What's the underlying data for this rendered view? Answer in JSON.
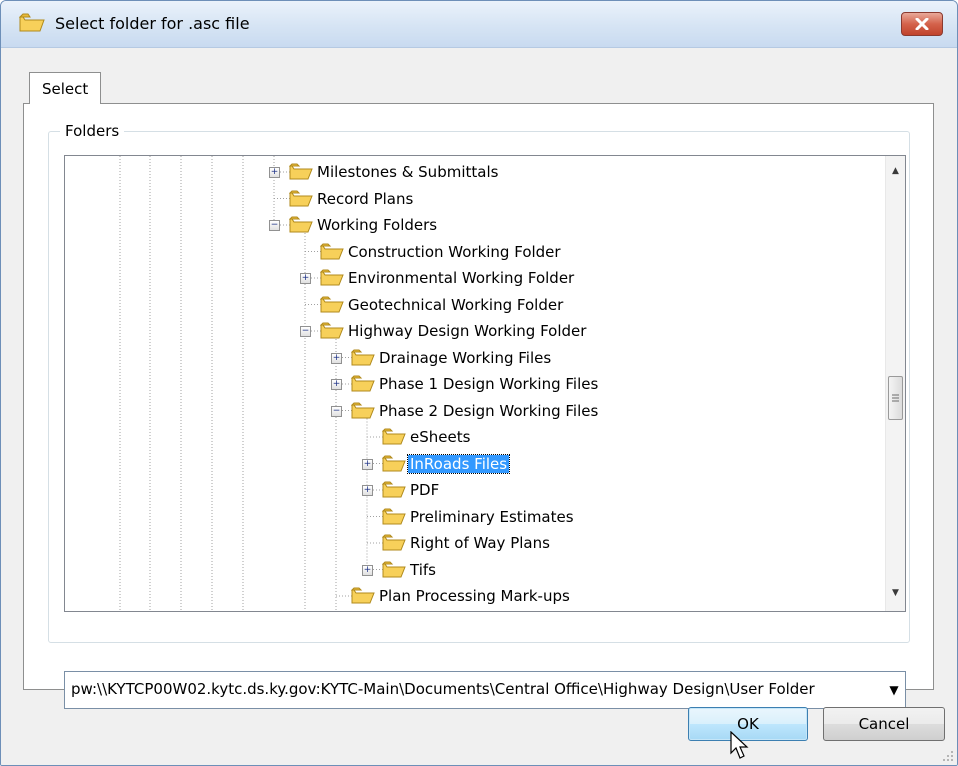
{
  "window": {
    "title": "Select folder for .asc file",
    "title_icon": "folder-icon",
    "close_icon": "close-icon"
  },
  "tabs": [
    {
      "label": "Select",
      "active": true
    }
  ],
  "folders_group": {
    "label": "Folders"
  },
  "tree": {
    "nodes": [
      {
        "label": "Milestones & Submittals",
        "depth": 0,
        "expander": "plus"
      },
      {
        "label": "Record Plans",
        "depth": 0,
        "expander": "none"
      },
      {
        "label": "Working Folders",
        "depth": 0,
        "expander": "minus"
      },
      {
        "label": "Construction Working Folder",
        "depth": 1,
        "expander": "none"
      },
      {
        "label": "Environmental Working Folder",
        "depth": 1,
        "expander": "plus"
      },
      {
        "label": "Geotechnical Working Folder",
        "depth": 1,
        "expander": "none"
      },
      {
        "label": "Highway Design Working Folder",
        "depth": 1,
        "expander": "minus"
      },
      {
        "label": "Drainage Working Files",
        "depth": 2,
        "expander": "plus"
      },
      {
        "label": "Phase 1 Design Working Files",
        "depth": 2,
        "expander": "plus"
      },
      {
        "label": "Phase 2 Design Working Files",
        "depth": 2,
        "expander": "minus"
      },
      {
        "label": "eSheets",
        "depth": 3,
        "expander": "none"
      },
      {
        "label": "InRoads Files",
        "depth": 3,
        "expander": "plus",
        "selected": true
      },
      {
        "label": "PDF",
        "depth": 3,
        "expander": "plus"
      },
      {
        "label": "Preliminary Estimates",
        "depth": 3,
        "expander": "none"
      },
      {
        "label": "Right of Way Plans",
        "depth": 3,
        "expander": "none"
      },
      {
        "label": "Tifs",
        "depth": 3,
        "expander": "plus"
      },
      {
        "label": "Plan Processing Mark-ups",
        "depth": 2,
        "expander": "none"
      }
    ]
  },
  "path_combo": {
    "value": "pw:\\\\KYTCP00W02.kytc.ds.ky.gov:KYTC-Main\\Documents\\Central Office\\Highway Design\\User Folder"
  },
  "buttons": {
    "ok": "OK",
    "cancel": "Cancel"
  },
  "colors": {
    "selection": "#3399ff",
    "folder": "#f5c842"
  }
}
